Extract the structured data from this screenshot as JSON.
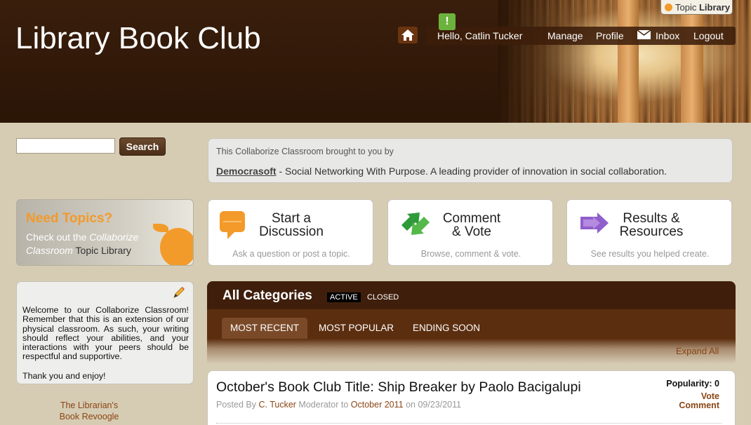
{
  "header": {
    "site_title": "Library Book Club",
    "topic_library_prefix": "Topic",
    "topic_library_bold": "Library",
    "notification_glyph": "!",
    "greeting": "Hello, Catlin Tucker",
    "nav": {
      "manage": "Manage",
      "profile": "Profile",
      "inbox": "Inbox",
      "logout": "Logout"
    }
  },
  "search": {
    "value": "",
    "button_label": "Search"
  },
  "sponsor": {
    "intro": "This Collaborize Classroom brought to you by",
    "link_text": "Democrasoft",
    "tagline": " - Social Networking With Purpose. A leading provider of innovation in social collaboration."
  },
  "need_topics": {
    "title": "Need Topics?",
    "text_pre": "Check out the ",
    "text_italic": "Collaborize Classroom",
    "text_post": " Topic Library"
  },
  "actions": [
    {
      "title_line1": "Start a",
      "title_line2": "Discussion",
      "subtitle": "Ask a question or post a topic.",
      "icon": "speech-bubble-icon"
    },
    {
      "title_line1": "Comment",
      "title_line2": "& Vote",
      "subtitle": "Browse, comment & vote.",
      "icon": "green-arrows-icon"
    },
    {
      "title_line1": "Results &",
      "title_line2": "Resources",
      "subtitle": "See results you helped create.",
      "icon": "purple-arrows-icon"
    }
  ],
  "welcome": {
    "text": "Welcome to our Collaborize Classroom! Remember that this is an extension of our physical classroom. As such, your writing should reflect your abilities, and your interactions with your peers should be respectful and supportive.",
    "thanks": "Thank you and enjoy!"
  },
  "librarian_link": {
    "line1": "The Librarian's",
    "line2": "Book Revoogle"
  },
  "categories": {
    "title": "All Categories",
    "filter_active": "ACTIVE",
    "filter_closed": "CLOSED",
    "tabs": [
      "MOST RECENT",
      "MOST POPULAR",
      "ENDING SOON"
    ],
    "expand_all": "Expand All"
  },
  "topic": {
    "title": "October's Book Club Title: Ship Breaker by Paolo Bacigalupi",
    "posted_by_label": "Posted By ",
    "author": "C. Tucker",
    "role_to": " Moderator to ",
    "category": "October 2011",
    "on_label": " on ",
    "date": "09/23/2011",
    "popularity": "Popularity: 0",
    "vote": "Vote",
    "comment": "Comment"
  },
  "colors": {
    "header_bg": "#2a1506",
    "page_bg": "#d6ccb4",
    "accent_orange": "#f29b2a",
    "link_brown": "#8b4513"
  }
}
